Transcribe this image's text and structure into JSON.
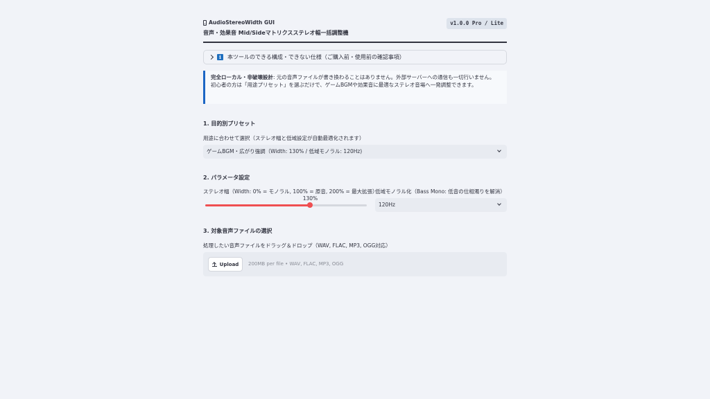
{
  "header": {
    "app_title": "AudioStereoWidth GUI",
    "subtitle": "音声・効果音 Mid/Sideマトリクスステレオ幅一括調整機",
    "version": "v1.0.0 Pro / Lite"
  },
  "expander": {
    "label": "本ツールのできる構成・できない仕様（ご購入前・使用前の確認事項）",
    "icon": "info-icon"
  },
  "callout": {
    "bold": "完全ローカル・非破壊設計",
    "line1": ": 元の音声ファイルが書き換わることはありません。外部サーバーへの通信も一切行いません。",
    "line2": "初心者の方は「用途プリセット」を選ぶだけで、ゲームBGMや効果音に最適なステレオ音場へ一発調整できます。",
    "accent_color": "#1c66c4"
  },
  "section1": {
    "title": "1. 目的別プリセット",
    "label": "用途に合わせて選択（ステレオ幅と低域設定が自動最適化されます）",
    "selected": "ゲームBGM・広がり強調（Width: 130% / 低域モノラル: 120Hz)"
  },
  "section2": {
    "title": "2. パラメータ設定",
    "width_label": "ステレオ幅（Width: 0% = モノラル, 100% = 原音, 200% = 最大拡張）",
    "width_value_text": "130%",
    "width_value": 130,
    "width_min": 0,
    "width_max": 200,
    "bass_label": "低域モノラル化（Bass Mono: 低音の位相濁りを解消）",
    "bass_selected": "120Hz",
    "slider_color": "#ef4f52"
  },
  "section3": {
    "title": "3. 対象音声ファイルの選択",
    "label": "処理したい音声ファイルをドラッグ＆ドロップ（WAV, FLAC, MP3, OGG対応）",
    "upload_label": "Upload",
    "hint": "200MB per file • WAV, FLAC, MP3, OGG"
  }
}
